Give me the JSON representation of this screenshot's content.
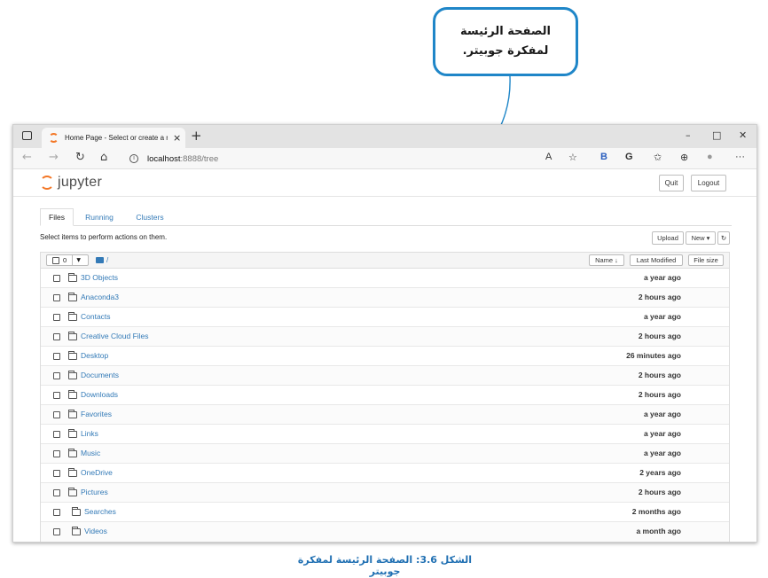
{
  "callout": {
    "line1": "الصفحة الرئيسة",
    "line2": "لمفكرة جوبيتر."
  },
  "caption": "الشكل 3.6: الصفحة الرئيسة لمفكرة جوبيتر",
  "browser": {
    "tab_title": "Home Page - Select or create a n",
    "tab_close": "×",
    "new_tab": "+",
    "win_min": "–",
    "win_max": "□",
    "win_close": "✕",
    "url_host": "localhost",
    "url_path": ":8888/tree",
    "info_glyph": "i",
    "toolbar": {
      "read_aloud": "A",
      "favorite": "☆",
      "b_ext": "B",
      "g_ext": "G",
      "favorites": "✩",
      "collections": "⊕",
      "profile": "●",
      "more": "···"
    },
    "nav": {
      "back": "←",
      "forward": "→",
      "refresh": "↻",
      "home": "⌂"
    }
  },
  "jupyter": {
    "logo_text": "jupyter",
    "quit_label": "Quit",
    "logout_label": "Logout",
    "tabs": [
      {
        "label": "Files",
        "active": true
      },
      {
        "label": "Running",
        "active": false
      },
      {
        "label": "Clusters",
        "active": false
      }
    ],
    "instruction": "Select items to perform actions on them.",
    "upload_label": "Upload",
    "new_label": "New ▾",
    "refresh_glyph": "↻",
    "select_count": "0",
    "select_dropdown": "▼",
    "breadcrumb": "/",
    "columns": {
      "name": "Name ↓",
      "last_modified": "Last Modified",
      "file_size": "File size"
    },
    "files": [
      {
        "name": "3D Objects",
        "modified": "a year ago"
      },
      {
        "name": "Anaconda3",
        "modified": "2 hours ago"
      },
      {
        "name": "Contacts",
        "modified": "a year ago"
      },
      {
        "name": "Creative Cloud Files",
        "modified": "2 hours ago"
      },
      {
        "name": "Desktop",
        "modified": "26 minutes ago"
      },
      {
        "name": "Documents",
        "modified": "2 hours ago"
      },
      {
        "name": "Downloads",
        "modified": "2 hours ago"
      },
      {
        "name": "Favorites",
        "modified": "a year ago"
      },
      {
        "name": "Links",
        "modified": "a year ago"
      },
      {
        "name": "Music",
        "modified": "a year ago"
      },
      {
        "name": "OneDrive",
        "modified": "2 years ago"
      },
      {
        "name": "Pictures",
        "modified": "2 hours ago"
      },
      {
        "name": "Searches",
        "modified": "2 months ago"
      },
      {
        "name": "Videos",
        "modified": "a month ago"
      }
    ]
  },
  "colors": {
    "accent": "#1f86c8",
    "jupyter_orange": "#f37726",
    "link": "#337ab7"
  }
}
